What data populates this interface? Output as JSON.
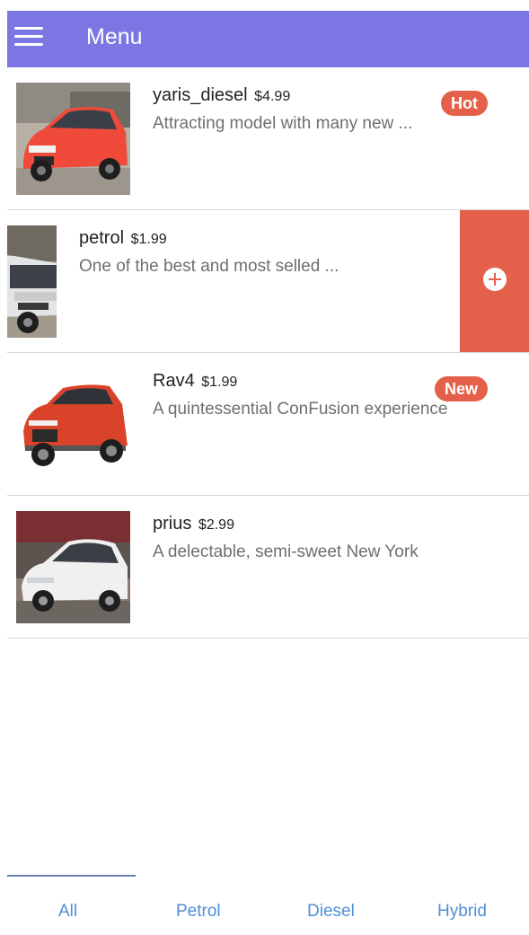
{
  "header": {
    "title": "Menu",
    "color": "#7b76e3",
    "menu_icon": "hamburger-icon"
  },
  "items": [
    {
      "name": "yaris_diesel",
      "price": "$4.99",
      "description": "Attracting model with many new ...",
      "badge": "Hot",
      "car_color": "#ef4a3a"
    },
    {
      "name": "petrol",
      "price": "$1.99",
      "description": "One of the best and most selled ...",
      "badge": "",
      "car_color": "#e8e8e8",
      "action_icon": "add-circle-icon"
    },
    {
      "name": "Rav4",
      "price": "$1.99",
      "description": "A quintessential ConFusion experience",
      "badge": "New",
      "car_color": "#d8432a"
    },
    {
      "name": "prius",
      "price": "$2.99",
      "description": "A delectable, semi-sweet New York",
      "badge": "",
      "car_color": "#f0f0f0"
    }
  ],
  "tabs": [
    {
      "label": "All",
      "active": true
    },
    {
      "label": "Petrol",
      "active": false
    },
    {
      "label": "Diesel",
      "active": false
    },
    {
      "label": "Hybrid",
      "active": false
    }
  ],
  "colors": {
    "accent": "#e4604a",
    "tab_text": "#4f8fd6"
  }
}
